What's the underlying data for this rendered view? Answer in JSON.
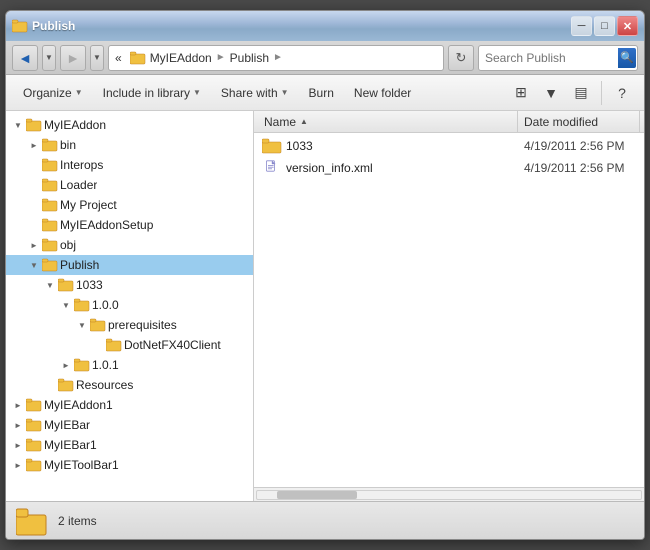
{
  "window": {
    "title": "Publish",
    "min_label": "─",
    "max_label": "□",
    "close_label": "✕"
  },
  "address_bar": {
    "back_icon": "◄",
    "forward_icon": "►",
    "dropdown_icon": "▼",
    "refresh_icon": "↻",
    "segments": [
      {
        "label": "« "
      },
      {
        "label": "MyIEAddon"
      },
      {
        "label": "►"
      },
      {
        "label": "Publish"
      },
      {
        "label": "►"
      }
    ],
    "search_placeholder": "Search Publish",
    "search_icon": "🔍"
  },
  "toolbar": {
    "organize_label": "Organize",
    "include_label": "Include in library",
    "share_label": "Share with",
    "burn_label": "Burn",
    "new_folder_label": "New folder",
    "view_icon": "≡",
    "preview_icon": "▤",
    "help_icon": "?"
  },
  "tree": {
    "items": [
      {
        "id": "myieaddon",
        "label": "MyIEAddon",
        "indent": 0,
        "expanded": true,
        "selected": false
      },
      {
        "id": "bin",
        "label": "bin",
        "indent": 1,
        "expanded": false,
        "selected": false
      },
      {
        "id": "interops",
        "label": "Interops",
        "indent": 1,
        "expanded": false,
        "selected": false
      },
      {
        "id": "loader",
        "label": "Loader",
        "indent": 1,
        "expanded": false,
        "selected": false
      },
      {
        "id": "myproject",
        "label": "My Project",
        "indent": 1,
        "expanded": false,
        "selected": false
      },
      {
        "id": "myieaddonsetup",
        "label": "MyIEAddonSetup",
        "indent": 1,
        "expanded": false,
        "selected": false
      },
      {
        "id": "obj",
        "label": "obj",
        "indent": 1,
        "expanded": false,
        "selected": false
      },
      {
        "id": "publish",
        "label": "Publish",
        "indent": 1,
        "expanded": true,
        "selected": true
      },
      {
        "id": "1033",
        "label": "1033",
        "indent": 2,
        "expanded": true,
        "selected": false
      },
      {
        "id": "100",
        "label": "1.0.0",
        "indent": 3,
        "expanded": true,
        "selected": false
      },
      {
        "id": "prerequisites",
        "label": "prerequisites",
        "indent": 4,
        "expanded": true,
        "selected": false
      },
      {
        "id": "dotnetfx40client",
        "label": "DotNetFX40Client",
        "indent": 5,
        "expanded": false,
        "selected": false
      },
      {
        "id": "101",
        "label": "1.0.1",
        "indent": 3,
        "expanded": false,
        "selected": false
      },
      {
        "id": "resources",
        "label": "Resources",
        "indent": 2,
        "expanded": false,
        "selected": false
      },
      {
        "id": "myieaddon1",
        "label": "MyIEAddon1",
        "indent": 0,
        "expanded": false,
        "selected": false
      },
      {
        "id": "myiebar",
        "label": "MyIEBar",
        "indent": 0,
        "expanded": false,
        "selected": false
      },
      {
        "id": "myiebar1",
        "label": "MyIEBar1",
        "indent": 0,
        "expanded": false,
        "selected": false
      },
      {
        "id": "myietoolbar1",
        "label": "MyIEToolBar1",
        "indent": 0,
        "expanded": false,
        "selected": false
      }
    ]
  },
  "columns": {
    "name_label": "Name",
    "date_label": "Date modified",
    "sort_arrow": "▲"
  },
  "files": [
    {
      "id": "folder-1033",
      "name": "1033",
      "type": "folder",
      "date": "4/19/2011 2:56 PM"
    },
    {
      "id": "file-version",
      "name": "version_info.xml",
      "type": "xml",
      "date": "4/19/2011 2:56 PM"
    }
  ],
  "status": {
    "item_count": "2 items"
  }
}
